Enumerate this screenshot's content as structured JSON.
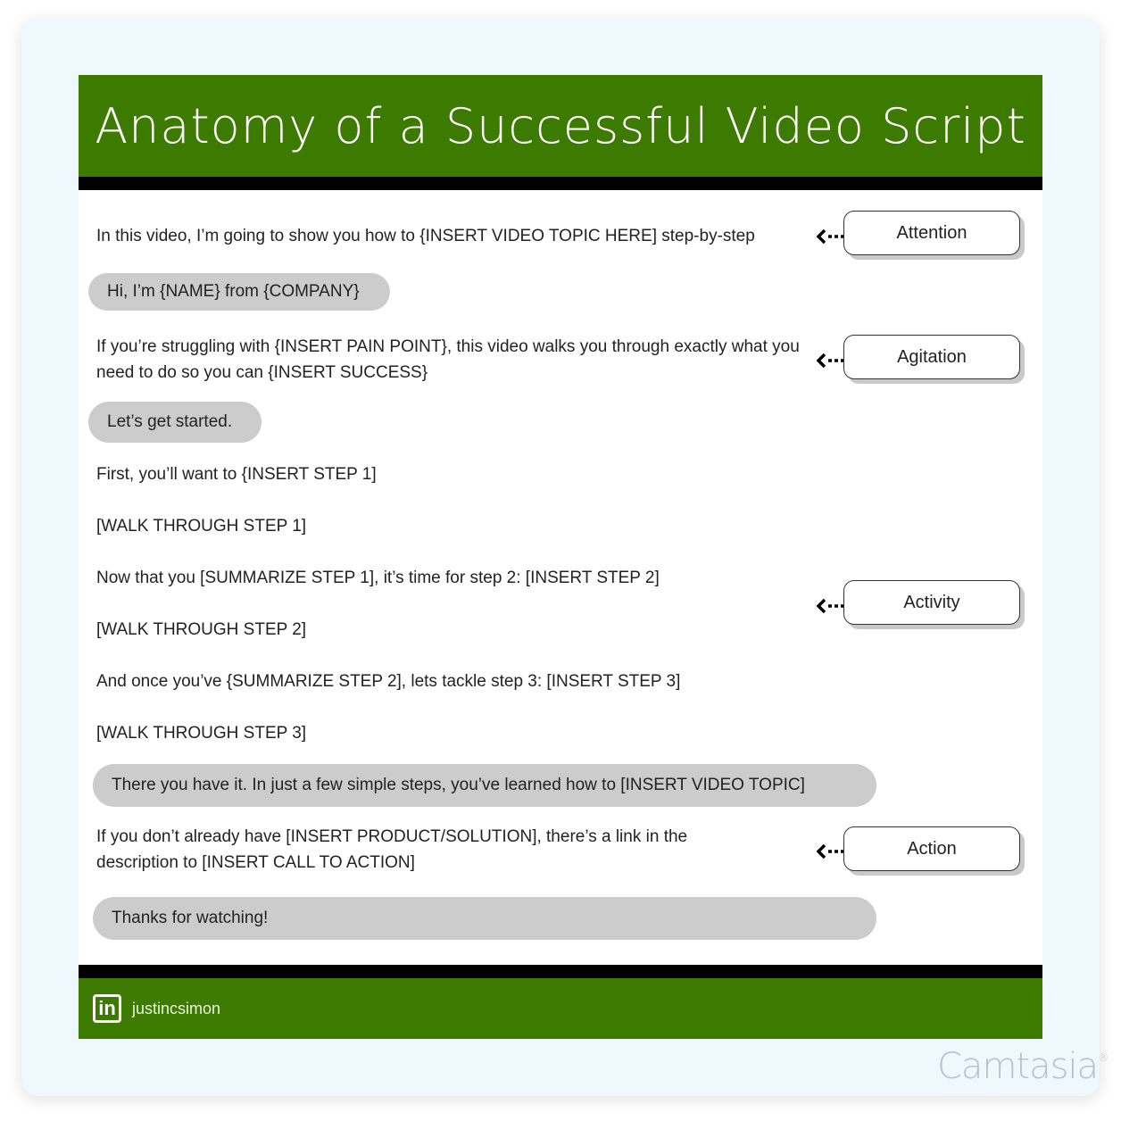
{
  "title": "Anatomy of a Successful Video Script",
  "colors": {
    "header_green": "#3c7a00",
    "pill_gray": "#cccccc",
    "card_bg": "#eef8fd"
  },
  "script_lines": [
    {
      "text": "In this video, I’m going to show you how to {INSERT VIDEO TOPIC HERE] step-by-step",
      "style": "plain"
    },
    {
      "text": "Hi, I’m {NAME} from {COMPANY}",
      "style": "pill"
    },
    {
      "text": "If you’re struggling with {INSERT PAIN POINT}, this video walks you through exactly what you need to do so you can {INSERT SUCCESS}",
      "style": "plain"
    },
    {
      "text": "Let’s get started.",
      "style": "pill"
    },
    {
      "text": "First, you’ll want to {INSERT STEP 1]",
      "style": "plain"
    },
    {
      "text": "[WALK THROUGH STEP 1]",
      "style": "plain"
    },
    {
      "text": "Now that you [SUMMARIZE STEP 1], it’s time for step 2: [INSERT STEP 2]",
      "style": "plain"
    },
    {
      "text": "[WALK THROUGH STEP 2]",
      "style": "plain"
    },
    {
      "text": "And once you’ve {SUMMARIZE STEP 2], lets tackle step 3: [INSERT STEP 3]",
      "style": "plain"
    },
    {
      "text": "[WALK THROUGH STEP 3]",
      "style": "plain"
    },
    {
      "text": "There you have it. In just a few simple steps, you’ve learned how to [INSERT VIDEO TOPIC]",
      "style": "pill"
    },
    {
      "text": "If you don’t already have [INSERT PRODUCT/SOLUTION], there’s a link in the description to [INSERT CALL TO ACTION]",
      "style": "plain"
    },
    {
      "text": "Thanks for watching!",
      "style": "pill"
    }
  ],
  "stage_tags": [
    {
      "label": "Attention",
      "icon": "dotted-arrow-left-icon"
    },
    {
      "label": "Agitation",
      "icon": "dotted-arrow-left-icon"
    },
    {
      "label": "Activity",
      "icon": "dotted-arrow-left-icon"
    },
    {
      "label": "Action",
      "icon": "dotted-arrow-left-icon"
    }
  ],
  "footer": {
    "icon": "linkedin-icon",
    "icon_glyph": "in",
    "handle": "justincsimon"
  },
  "watermark": {
    "text": "Camtasia",
    "mark": "®"
  }
}
